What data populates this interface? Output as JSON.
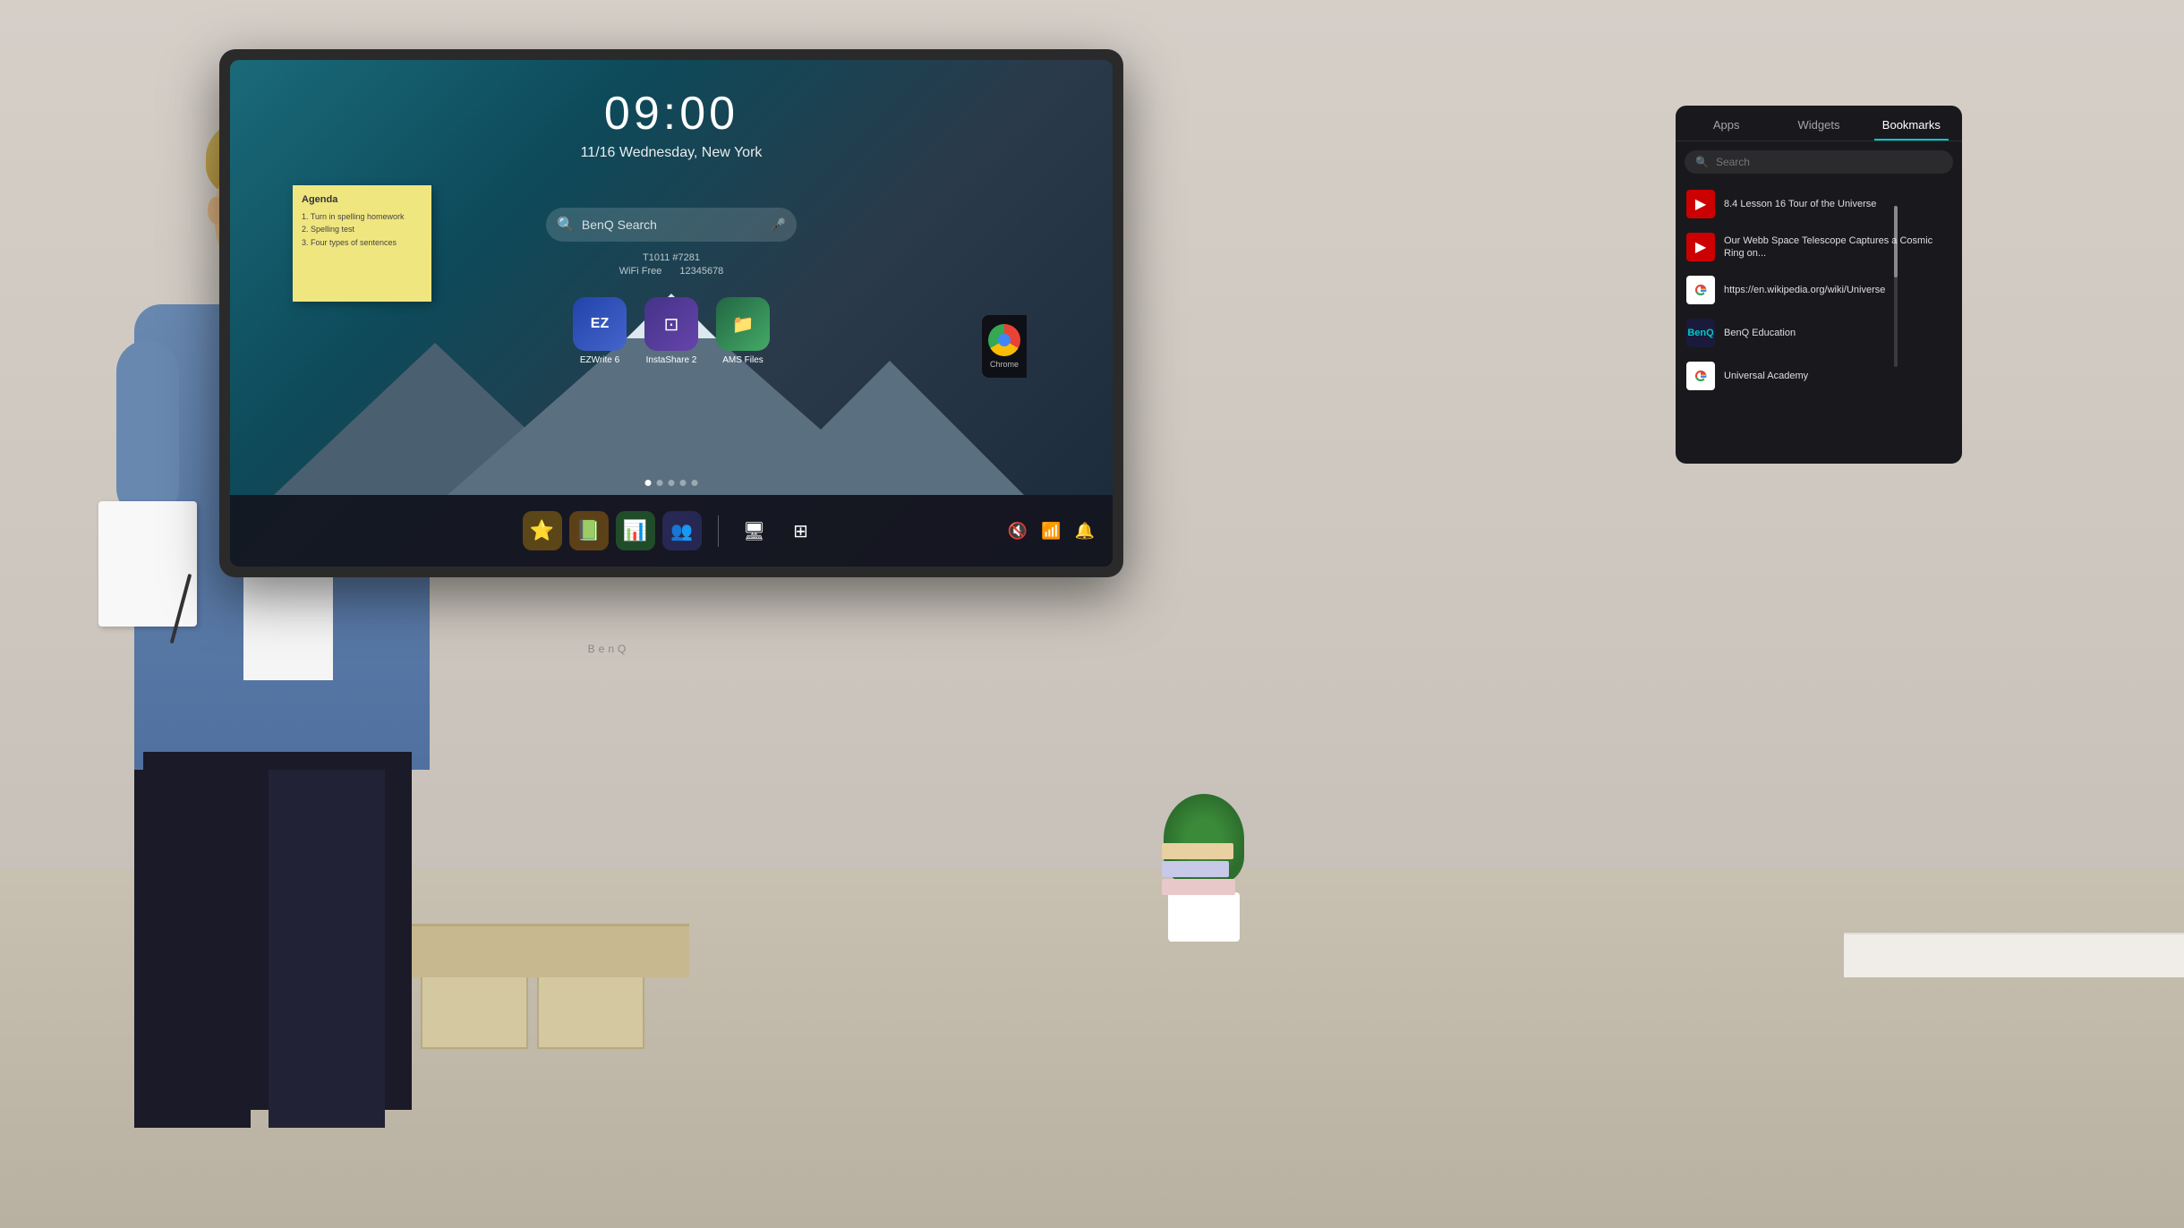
{
  "scene": {
    "background": "classroom"
  },
  "clock": {
    "time": "09:00",
    "date": "11/16 Wednesday, New York"
  },
  "search": {
    "placeholder": "BenQ Search"
  },
  "sticky_note": {
    "title": "Agenda",
    "items": [
      "1. Turn in spelling homework",
      "2. Spelling test",
      "3. Four types of sentences"
    ]
  },
  "device_info": {
    "room": "T1011 #7281",
    "wifi": "WiFi Free",
    "phone": "12345678"
  },
  "app_icons": [
    {
      "label": "EZWrite 6",
      "bg": "#2244aa"
    },
    {
      "label": "InstaShare 2",
      "bg": "#553399"
    },
    {
      "label": "AMS Files",
      "bg": "#226644"
    }
  ],
  "dots": [
    {
      "active": true
    },
    {
      "active": false
    },
    {
      "active": false
    },
    {
      "active": false
    },
    {
      "active": false
    }
  ],
  "panel": {
    "tabs": [
      {
        "label": "Apps",
        "active": false
      },
      {
        "label": "Widgets",
        "active": false
      },
      {
        "label": "Bookmarks",
        "active": true
      }
    ],
    "search_placeholder": "Search",
    "bookmarks": [
      {
        "title": "8.4 Lesson 16 Tour of the Universe",
        "icon_type": "youtube",
        "url": ""
      },
      {
        "title": "Our Webb Space Telescope Captures a Cosmic Ring on...",
        "icon_type": "youtube",
        "url": ""
      },
      {
        "title": "https://en.wikipedia.org/wiki/Universe",
        "icon_type": "google",
        "url": "https://en.wikipedia.org/wiki/Universe"
      },
      {
        "title": "BenQ Education",
        "icon_type": "benq",
        "url": ""
      },
      {
        "title": "Universal Academy",
        "icon_type": "google",
        "url": ""
      }
    ]
  },
  "taskbar": {
    "center_icons": [
      "⭐",
      "📚",
      "📊",
      "👥"
    ],
    "right_icons": [
      "🔇",
      "📶",
      "🔔"
    ]
  },
  "benq_brand": "BenQ"
}
